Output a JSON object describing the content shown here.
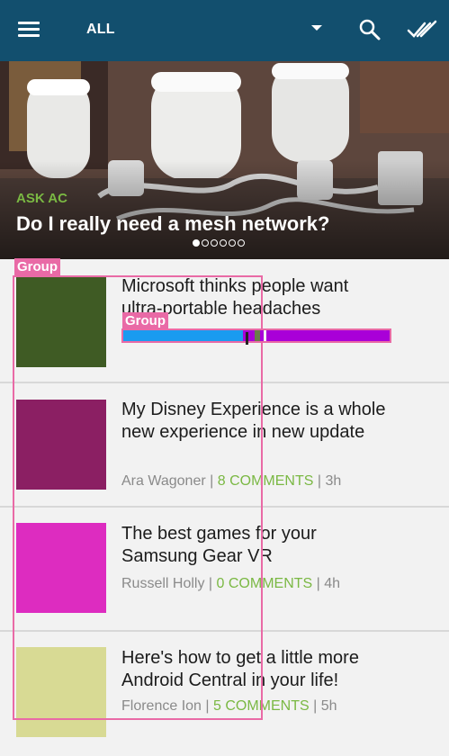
{
  "appbar": {
    "filter_label": "ALL",
    "colors": {
      "bar": "#124f6e"
    }
  },
  "hero": {
    "kicker": "ASK AC",
    "headline": "Do I really need a mesh network?",
    "carousel": {
      "count": 6,
      "active_index": 0
    }
  },
  "articles": [
    {
      "title": "Microsoft thinks people want ultra-portable headaches",
      "author": "",
      "comments": "",
      "age": "",
      "thumb_color": "#3f5b24"
    },
    {
      "title": "My Disney Experience is a whole new experience in new update",
      "author": "Ara Wagoner",
      "comments": "8 COMMENTS",
      "age": "3h",
      "thumb_color": "#8b1f63"
    },
    {
      "title": "The best games for your Samsung Gear VR",
      "author": "Russell Holly",
      "comments": "0 COMMENTS",
      "age": "4h",
      "thumb_color": "#dd2cc0"
    },
    {
      "title": "Here's how to get a little more Android Central in your life!",
      "author": "Florence Ion",
      "comments": "5 COMMENTS",
      "age": "5h",
      "thumb_color": "#d8da94"
    }
  ],
  "annotations": {
    "group_label_1": "Group",
    "group_label_2": "Group"
  },
  "progress": {
    "value": 0.45,
    "colors": {
      "fill": "#1a9bf0",
      "track": "#a900d8"
    }
  }
}
